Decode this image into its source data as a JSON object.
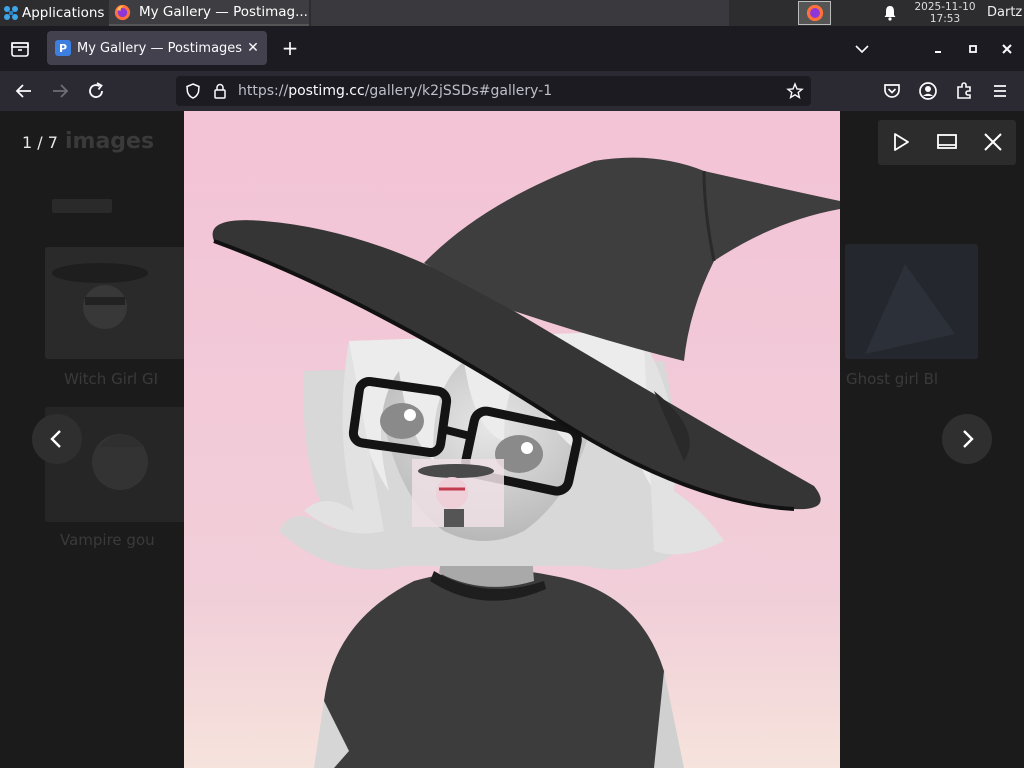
{
  "taskbar": {
    "apps_label": "Applications",
    "task_label": "My Gallery — Postimag...",
    "clock_date": "2025-11-10",
    "clock_time": "17:53",
    "user": "Dartz"
  },
  "browser": {
    "tab_title": "My Gallery — Postimages",
    "tab_favicon_letter": "P",
    "url_scheme": "https://",
    "url_host": "postimg.cc",
    "url_path": "/gallery/k2jSSDs#gallery-1",
    "accent": "#3d7fe0"
  },
  "viewer": {
    "counter": "1 / 7",
    "icons": [
      "play-icon",
      "fullscreen-icon",
      "close-icon",
      "chevron-left-icon",
      "chevron-right-icon"
    ]
  },
  "background_gallery": {
    "title": "images",
    "captions": [
      "Witch Girl GI",
      "Vampire gou",
      "Ghost girl Bl"
    ]
  },
  "colors": {
    "page_bg": "#1b1b1b",
    "image_bg_top": "#f3c3d6",
    "image_bg_bottom": "#f5ddde"
  }
}
